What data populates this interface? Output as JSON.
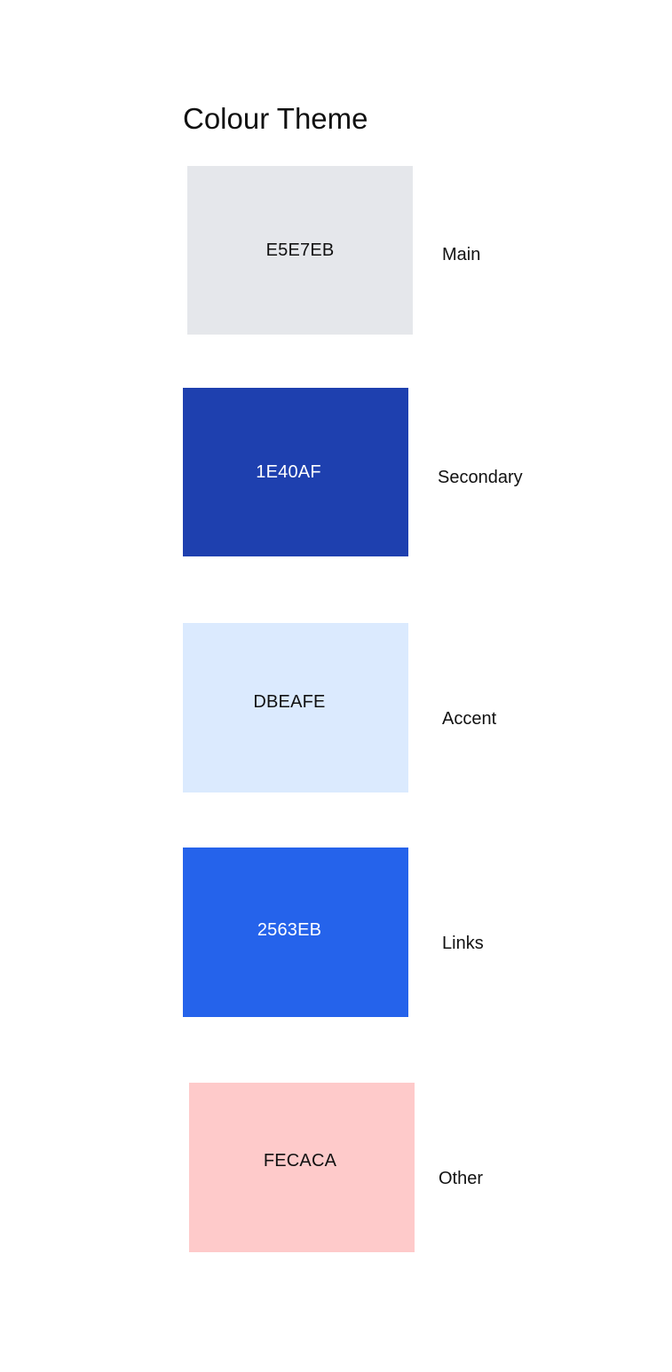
{
  "title": "Colour Theme",
  "colors": [
    {
      "hex": "E5E7EB",
      "name": "Main",
      "swatch_color": "#E5E7EB",
      "text_color": "#111111"
    },
    {
      "hex": "1E40AF",
      "name": "Secondary",
      "swatch_color": "#1E40AF",
      "text_color": "#FFFFFF"
    },
    {
      "hex": "DBEAFE",
      "name": "Accent",
      "swatch_color": "#DBEAFE",
      "text_color": "#111111"
    },
    {
      "hex": "2563EB",
      "name": "Links",
      "swatch_color": "#2563EB",
      "text_color": "#FFFFFF"
    },
    {
      "hex": "FECACA",
      "name": "Other",
      "swatch_color": "#FECACA",
      "text_color": "#111111"
    }
  ]
}
